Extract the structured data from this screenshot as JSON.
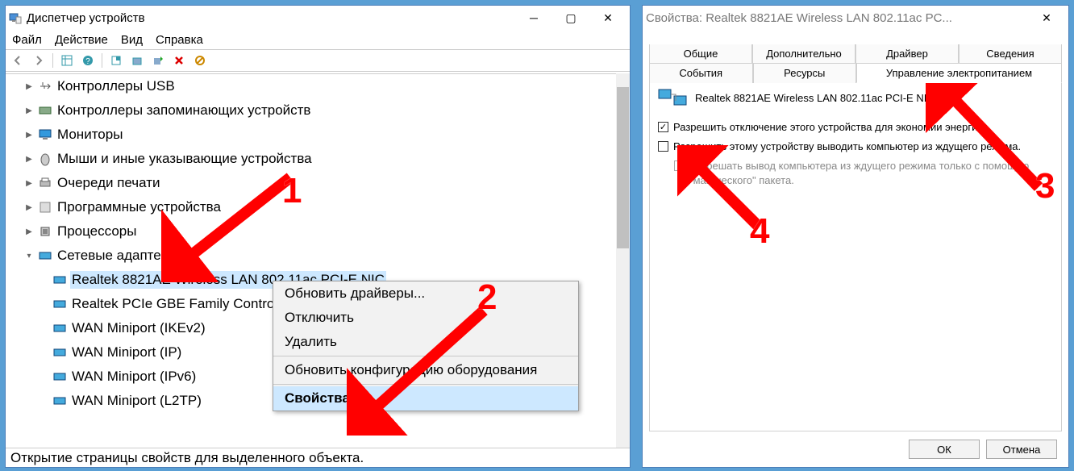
{
  "dm": {
    "title": "Диспетчер устройств",
    "menu": {
      "file": "Файл",
      "action": "Действие",
      "view": "Вид",
      "help": "Справка"
    },
    "tree": [
      {
        "label": "Контроллеры USB"
      },
      {
        "label": "Контроллеры запоминающих устройств"
      },
      {
        "label": "Мониторы"
      },
      {
        "label": "Мыши и иные указывающие устройства"
      },
      {
        "label": "Очереди печати"
      },
      {
        "label": "Программные устройства"
      },
      {
        "label": "Процессоры"
      },
      {
        "label": "Сетевые адаптеры",
        "expanded": true,
        "children": [
          {
            "label": "Realtek 8821AE Wireless LAN 802.11ac PCI-E NIC",
            "selected": true
          },
          {
            "label": "Realtek PCIe GBE Family Controller"
          },
          {
            "label": "WAN Miniport (IKEv2)"
          },
          {
            "label": "WAN Miniport (IP)"
          },
          {
            "label": "WAN Miniport (IPv6)"
          },
          {
            "label": "WAN Miniport (L2TP)"
          }
        ]
      }
    ],
    "status": "Открытие страницы свойств для выделенного объекта."
  },
  "ctx": {
    "update": "Обновить драйверы...",
    "disable": "Отключить",
    "delete": "Удалить",
    "rescan": "Обновить конфигурацию оборудования",
    "props": "Свойства"
  },
  "dlg": {
    "title": "Свойства: Realtek 8821AE Wireless LAN 802.11ac PC...",
    "tabs": {
      "general": "Общие",
      "advanced": "Дополнительно",
      "driver": "Драйвер",
      "details": "Сведения",
      "events": "События",
      "resources": "Ресурсы",
      "power": "Управление электропитанием"
    },
    "devname": "Realtek 8821AE Wireless LAN 802.11ac PCI-E NIC",
    "chk1": "Разрешить отключение этого устройства для экономии энергии.",
    "chk2": "Разрешить этому устройству выводить компьютер из ждущего режима.",
    "chk3": "Разрешать вывод компьютера из ждущего режима только с помощью \"магического\" пакета.",
    "ok": "ОК",
    "cancel": "Отмена"
  },
  "markers": {
    "m1": "1",
    "m2": "2",
    "m3": "3",
    "m4": "4"
  }
}
